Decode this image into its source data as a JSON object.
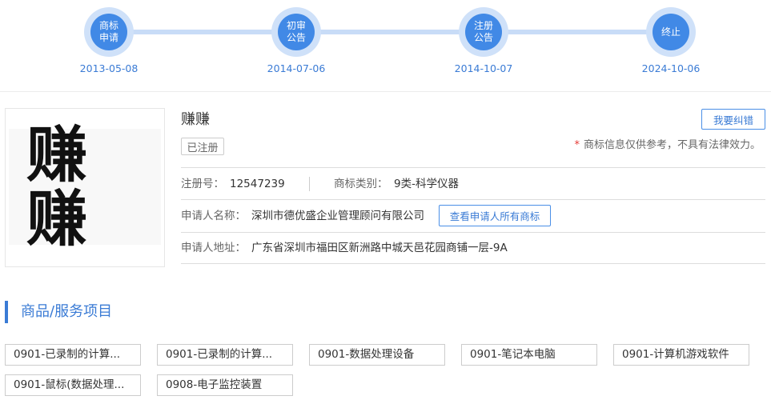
{
  "timeline": {
    "steps": [
      {
        "label_lines": [
          "商标",
          "申请"
        ],
        "date": "2013-05-08"
      },
      {
        "label_lines": [
          "初审",
          "公告"
        ],
        "date": "2014-07-06"
      },
      {
        "label_lines": [
          "注册",
          "公告"
        ],
        "date": "2014-10-07"
      },
      {
        "label_lines": [
          "终止"
        ],
        "date": "2024-10-06"
      }
    ]
  },
  "trademark": {
    "image_text": "赚赚",
    "name": "赚赚",
    "status": "已注册",
    "report_button": "我要纠错",
    "disclaimer_mark": "*",
    "disclaimer": "商标信息仅供参考，不具有法律效力。",
    "reg_no_label": "注册号：",
    "reg_no": "12547239",
    "class_label": "商标类别：",
    "class_value": "9类-科学仪器",
    "applicant_label": "申请人名称：",
    "applicant": "深圳市德优盛企业管理顾问有限公司",
    "view_all_button": "查看申请人所有商标",
    "address_label": "申请人地址：",
    "address": "广东省深圳市福田区新洲路中城天邑花园商铺一层-9A"
  },
  "services": {
    "title": "商品/服务项目",
    "items": [
      "0901-已录制的计算...",
      "0901-已录制的计算...",
      "0901-数据处理设备",
      "0901-笔记本电脑",
      "0901-计算机游戏软件",
      "0901-鼠标(数据处理...",
      "0908-电子监控装置"
    ]
  },
  "colors": {
    "accent": "#3a7bd5",
    "timeline_circle": "#4189e6",
    "timeline_ring": "#cfe1f9",
    "disclaimer_mark": "#e53935",
    "border": "#cccccc"
  }
}
